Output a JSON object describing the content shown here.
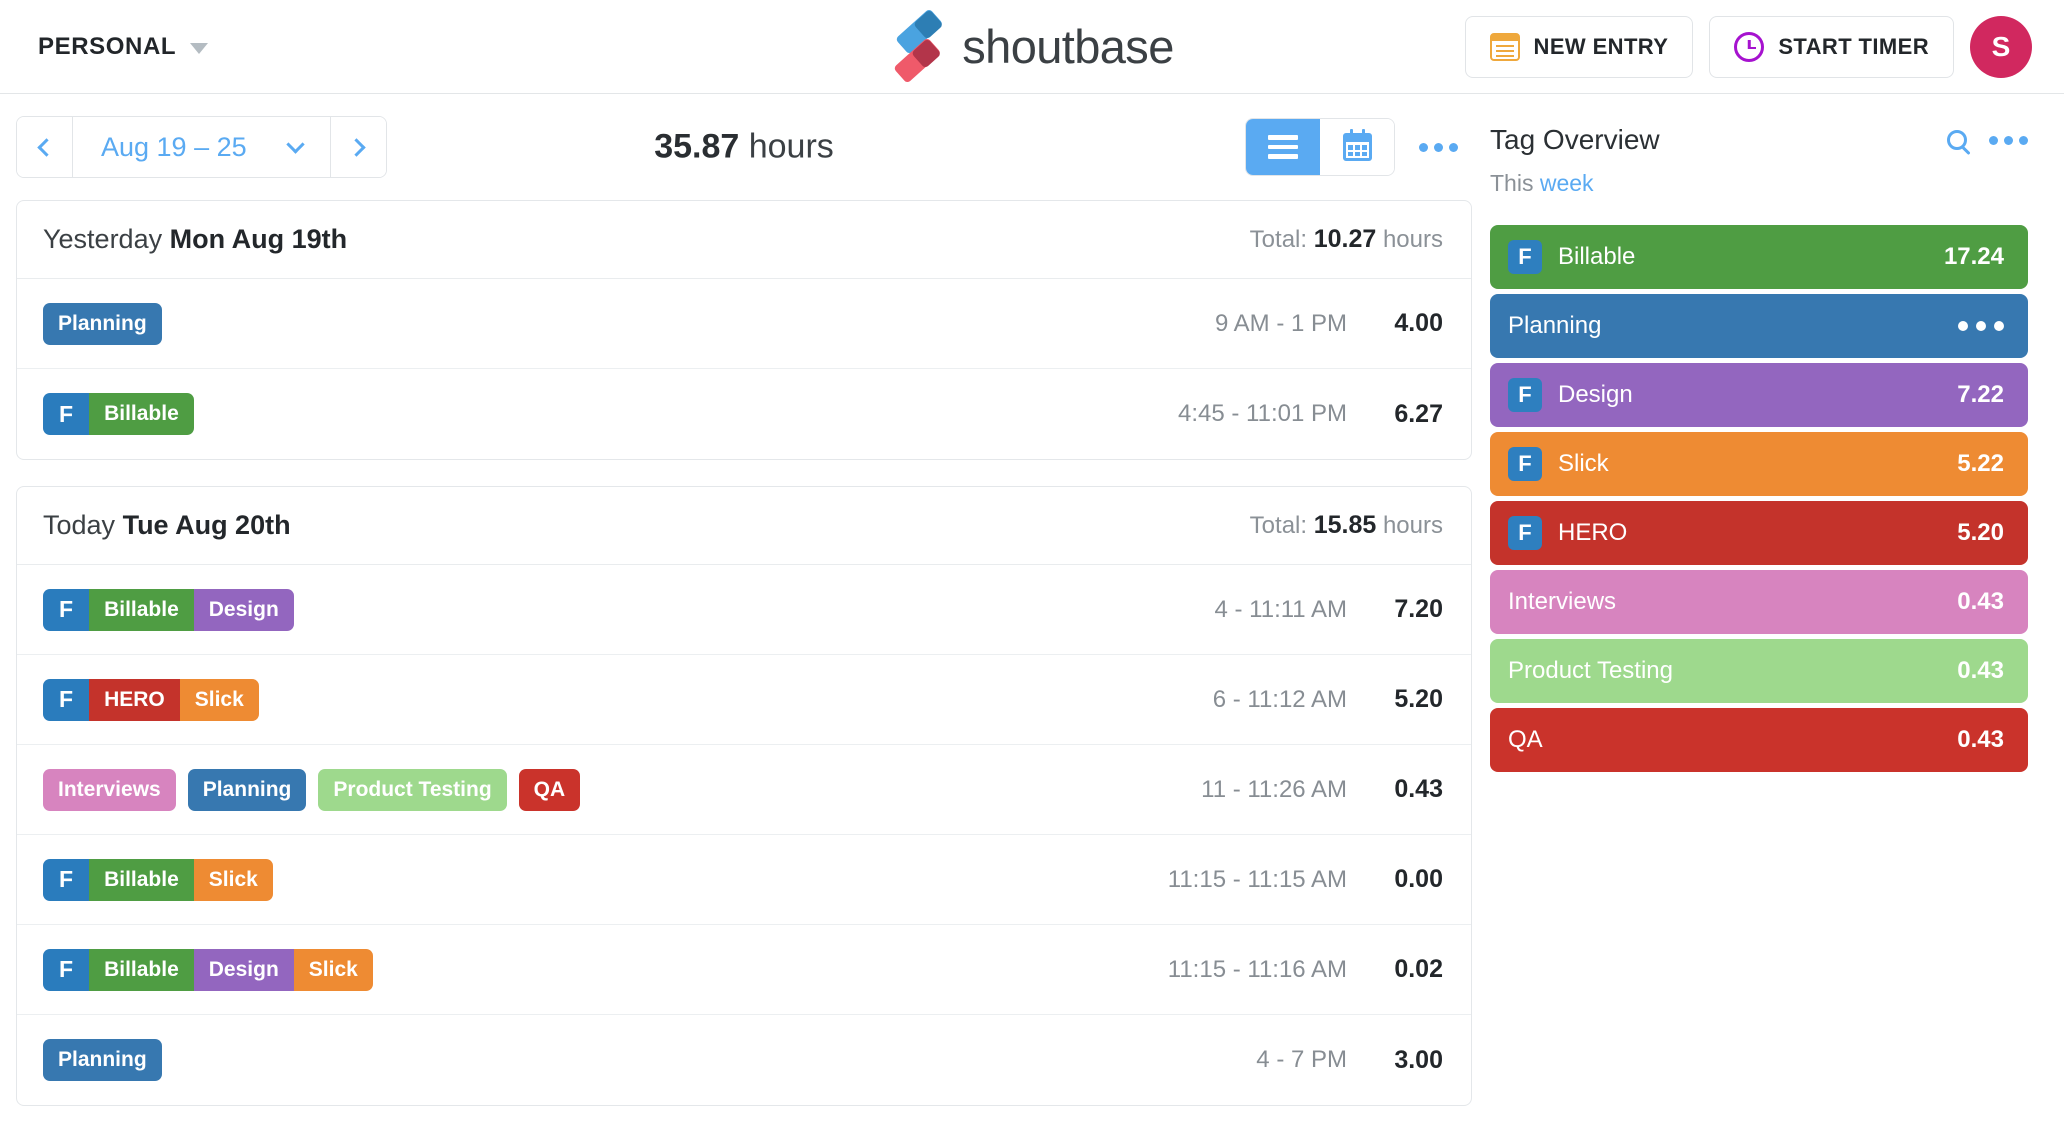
{
  "header": {
    "workspace_label": "PERSONAL",
    "brand_name": "shoutbase",
    "new_entry_label": "NEW ENTRY",
    "start_timer_label": "START TIMER",
    "avatar_initial": "S"
  },
  "toolbar": {
    "date_range": "Aug 19 – 25",
    "total_value": "35.87",
    "total_unit": "hours",
    "view_list": "list-view",
    "view_calendar": "calendar-view"
  },
  "days": [
    {
      "relative": "Yesterday",
      "date": "Mon Aug 19th",
      "total_prefix": "Total:",
      "total_value": "10.27",
      "total_unit": "hours",
      "entries": [
        {
          "time": "9 AM - 1 PM",
          "amount": "4.00",
          "pills": [
            {
              "segments": [
                {
                  "text": "Planning",
                  "color": "#3778b0"
                }
              ]
            }
          ]
        },
        {
          "time": "4:45 - 11:01 PM",
          "amount": "6.27",
          "pills": [
            {
              "segments": [
                {
                  "text": "F",
                  "color": "#2a7cbd"
                },
                {
                  "text": "Billable",
                  "color": "#4f9d43"
                }
              ]
            }
          ]
        }
      ]
    },
    {
      "relative": "Today",
      "date": "Tue Aug 20th",
      "total_prefix": "Total:",
      "total_value": "15.85",
      "total_unit": "hours",
      "entries": [
        {
          "time": "4 - 11:11 AM",
          "amount": "7.20",
          "pills": [
            {
              "segments": [
                {
                  "text": "F",
                  "color": "#2a7cbd"
                },
                {
                  "text": "Billable",
                  "color": "#4f9d43"
                },
                {
                  "text": "Design",
                  "color": "#9366bf"
                }
              ]
            }
          ]
        },
        {
          "time": "6 - 11:12 AM",
          "amount": "5.20",
          "pills": [
            {
              "segments": [
                {
                  "text": "F",
                  "color": "#2a7cbd"
                },
                {
                  "text": "HERO",
                  "color": "#c4332b"
                },
                {
                  "text": "Slick",
                  "color": "#ee8b33"
                }
              ]
            }
          ]
        },
        {
          "time": "11 - 11:26 AM",
          "amount": "0.43",
          "pills": [
            {
              "segments": [
                {
                  "text": "Interviews",
                  "color": "#d784bf"
                }
              ]
            },
            {
              "segments": [
                {
                  "text": "Planning",
                  "color": "#3778b0"
                }
              ]
            },
            {
              "segments": [
                {
                  "text": "Product Testing",
                  "color": "#9ed98d"
                }
              ]
            },
            {
              "segments": [
                {
                  "text": "QA",
                  "color": "#ca332b"
                }
              ]
            }
          ]
        },
        {
          "time": "11:15 - 11:15 AM",
          "amount": "0.00",
          "pills": [
            {
              "segments": [
                {
                  "text": "F",
                  "color": "#2a7cbd"
                },
                {
                  "text": "Billable",
                  "color": "#4f9d43"
                },
                {
                  "text": "Slick",
                  "color": "#ee8b33"
                }
              ]
            }
          ]
        },
        {
          "time": "11:15 - 11:16 AM",
          "amount": "0.02",
          "pills": [
            {
              "segments": [
                {
                  "text": "F",
                  "color": "#2a7cbd"
                },
                {
                  "text": "Billable",
                  "color": "#4f9d43"
                },
                {
                  "text": "Design",
                  "color": "#9366bf"
                },
                {
                  "text": "Slick",
                  "color": "#ee8b33"
                }
              ]
            }
          ]
        },
        {
          "time": "4 - 7 PM",
          "amount": "3.00",
          "pills": [
            {
              "segments": [
                {
                  "text": "Planning",
                  "color": "#3778b0"
                }
              ]
            }
          ]
        }
      ]
    }
  ],
  "tag_overview": {
    "title": "Tag Overview",
    "sub_prefix": "This",
    "sub_link": "week",
    "rows": [
      {
        "f": "F",
        "name": "Billable",
        "value": "17.24",
        "color": "#4f9d43",
        "show_dots": false
      },
      {
        "f": null,
        "name": "Planning",
        "value": "",
        "color": "#3778b0",
        "show_dots": true
      },
      {
        "f": "F",
        "name": "Design",
        "value": "7.22",
        "color": "#9366bf",
        "show_dots": false
      },
      {
        "f": "F",
        "name": "Slick",
        "value": "5.22",
        "color": "#ee8b33",
        "show_dots": false
      },
      {
        "f": "F",
        "name": "HERO",
        "value": "5.20",
        "color": "#c4332b",
        "show_dots": false
      },
      {
        "f": null,
        "name": "Interviews",
        "value": "0.43",
        "color": "#d784bf",
        "show_dots": false
      },
      {
        "f": null,
        "name": "Product Testing",
        "value": "0.43",
        "color": "#9ed98d",
        "show_dots": false
      },
      {
        "f": null,
        "name": "QA",
        "value": "0.43",
        "color": "#ca332b",
        "show_dots": false
      }
    ]
  },
  "icons": {
    "workspace_chevron": "chevron-down-icon",
    "new_entry": "list-icon",
    "start_timer": "clock-icon",
    "prev": "chevron-left-icon",
    "next": "chevron-right-icon",
    "search": "search-icon",
    "more": "ellipsis-icon"
  }
}
